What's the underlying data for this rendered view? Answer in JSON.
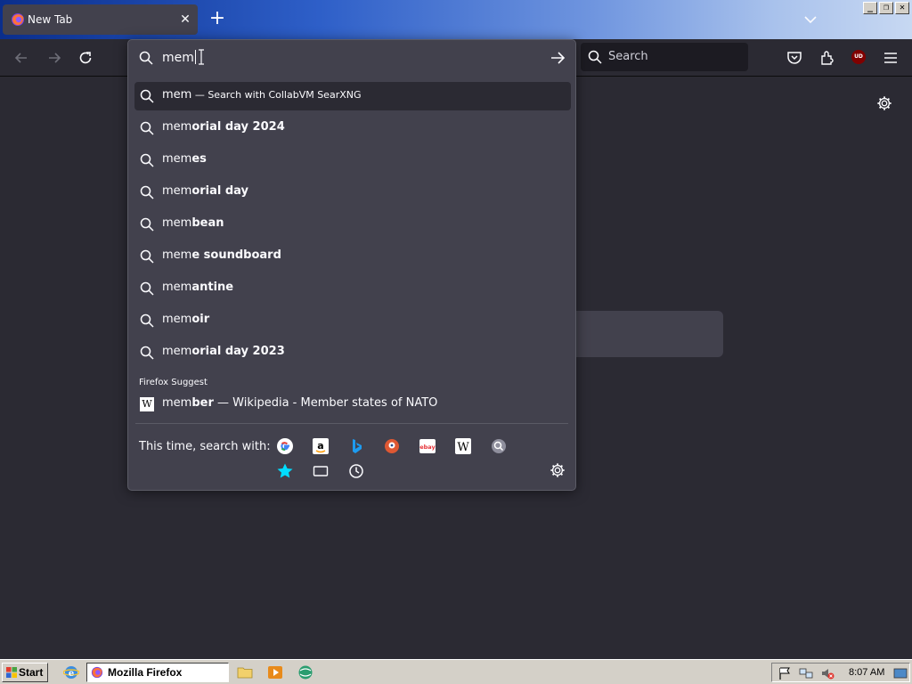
{
  "window": {
    "tab_title": "New Tab",
    "tab_close": "✕",
    "new_tab": "+",
    "controls": [
      "_",
      "❐",
      "✕"
    ]
  },
  "navbar": {
    "search_placeholder": "Search",
    "ublock_label": "UD"
  },
  "urlbar": {
    "query": "mem",
    "suggestions": [
      {
        "typed": "mem",
        "bold": "",
        "action": " — Search with CollabVM SearXNG",
        "selected": true
      },
      {
        "typed": "mem",
        "bold": "orial day 2024"
      },
      {
        "typed": "mem",
        "bold": "es"
      },
      {
        "typed": "mem",
        "bold": "orial day"
      },
      {
        "typed": "mem",
        "bold": "bean"
      },
      {
        "typed": "mem",
        "bold": "e soundboard"
      },
      {
        "typed": "mem",
        "bold": "antine"
      },
      {
        "typed": "mem",
        "bold": "oir"
      },
      {
        "typed": "mem",
        "bold": "orial day 2023"
      }
    ],
    "firefox_suggest": {
      "header": "Firefox Suggest",
      "icon_letter": "W",
      "typed": "mem",
      "bold": "ber",
      "rest": " — Wikipedia - Member states of NATO"
    },
    "oneoff_label": "This time, search with:",
    "engines": [
      "google-icon",
      "amazon-icon",
      "bing-icon",
      "duckduckgo-icon",
      "ebay-icon",
      "wikipedia-icon",
      "searxng-icon"
    ],
    "local_modes": [
      "bookmarks-icon",
      "tabs-icon",
      "history-icon"
    ]
  },
  "taskbar": {
    "start_label": "Start",
    "task_label": "Mozilla Firefox",
    "clock": "8:07 AM"
  },
  "colors": {
    "accent": "#00ddff",
    "panel": "#42414d",
    "page": "#2b2a33"
  }
}
